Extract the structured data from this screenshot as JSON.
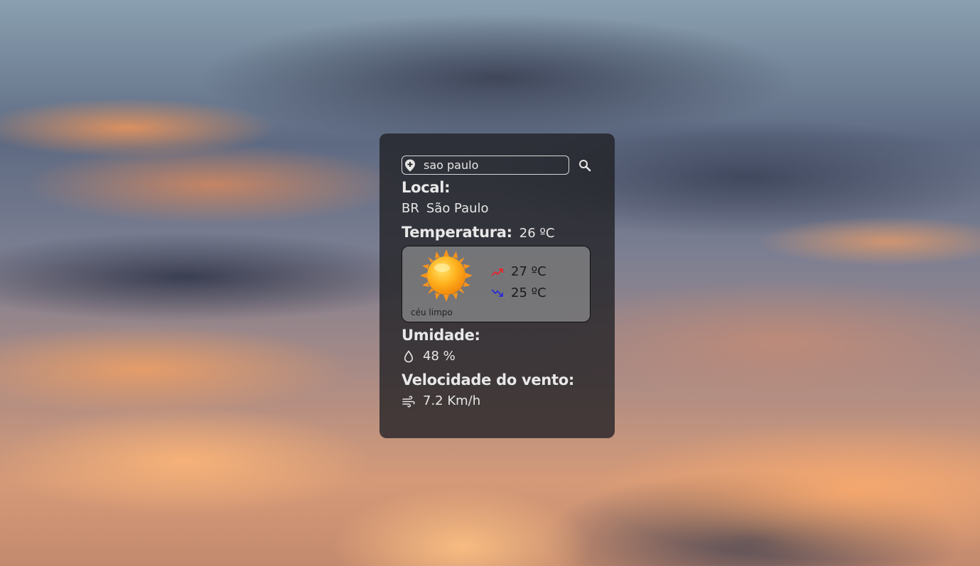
{
  "search": {
    "value": "sao paulo",
    "icon": "location-pin-icon",
    "button_icon": "search-icon"
  },
  "local": {
    "heading": "Local:",
    "country": "BR",
    "city": "São Paulo"
  },
  "temperature": {
    "heading": "Temperatura:",
    "current": "26 ºC",
    "condition": "céu limpo",
    "condition_icon": "sun-icon",
    "max": "27 ºC",
    "min": "25 ºC",
    "max_icon_color": "#e8232a",
    "min_icon_color": "#2b2bd6"
  },
  "humidity": {
    "heading": "Umidade:",
    "value": "48 %",
    "icon": "water-drop-icon"
  },
  "wind": {
    "heading": "Velocidade do vento:",
    "value": "7.2 Km/h",
    "icon": "wind-icon"
  }
}
